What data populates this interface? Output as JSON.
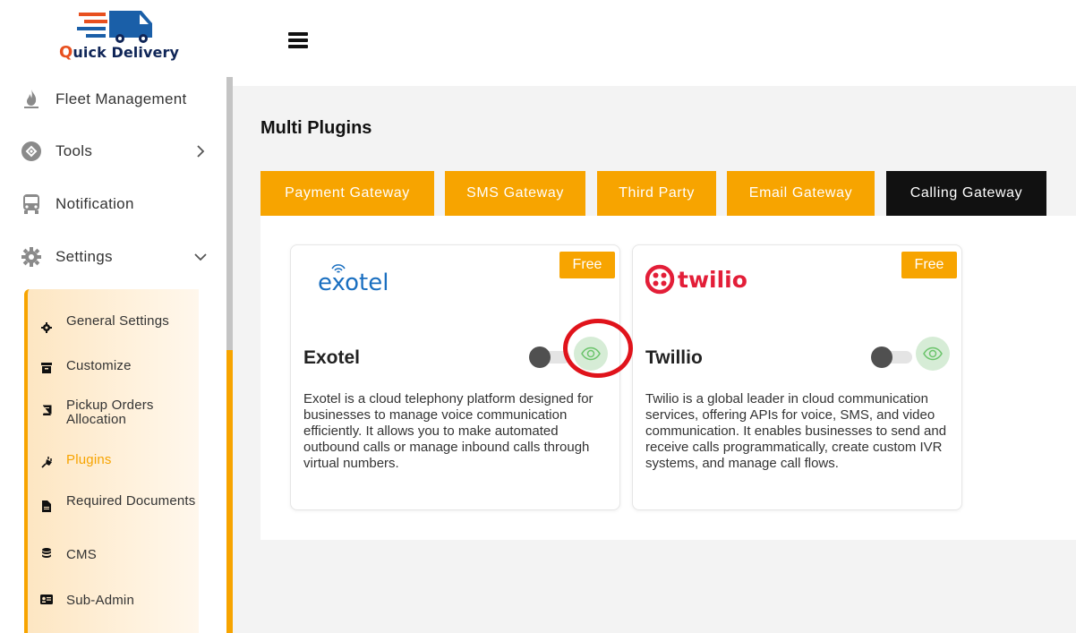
{
  "brand": {
    "name_first": "Q",
    "name_rest": "uick Delivery"
  },
  "sidebar": {
    "items": [
      {
        "label": "Fleet Management",
        "icon": "fire-icon"
      },
      {
        "label": "Tools",
        "icon": "tools-icon"
      },
      {
        "label": "Notification",
        "icon": "bus-icon"
      },
      {
        "label": "Settings",
        "icon": "gear-icon"
      }
    ],
    "submenu": [
      {
        "label": "General Settings",
        "icon": "gear-icon"
      },
      {
        "label": "Customize",
        "icon": "archive-icon"
      },
      {
        "label": "Pickup Orders Allocation",
        "icon": "book-icon"
      },
      {
        "label": "Plugins",
        "icon": "plug-icon",
        "active": true
      },
      {
        "label": "Required Documents",
        "icon": "file-icon"
      },
      {
        "label": "CMS",
        "icon": "database-icon"
      },
      {
        "label": "Sub-Admin",
        "icon": "id-card-icon"
      }
    ]
  },
  "main": {
    "title": "Multi Plugins",
    "tabs": [
      {
        "label": "Payment Gateway"
      },
      {
        "label": "SMS Gateway"
      },
      {
        "label": "Third Party"
      },
      {
        "label": "Email Gateway"
      },
      {
        "label": "Calling Gateway",
        "active": true
      }
    ],
    "plugins": [
      {
        "name": "Exotel",
        "logo_text": "exotel",
        "badge": "Free",
        "enabled": false,
        "description": "Exotel is a cloud telephony platform designed for businesses to manage voice communication efficiently. It allows you to make automated outbound calls or manage inbound calls through virtual numbers."
      },
      {
        "name": "Twillio",
        "logo_text": "twilio",
        "badge": "Free",
        "enabled": false,
        "description": "Twilio is a global leader in cloud communication services, offering APIs for voice, SMS, and video communication. It enables businesses to send and receive calls programmatically, create custom IVR systems, and manage call flows."
      }
    ]
  },
  "colors": {
    "accent": "#f7a400",
    "active_tab": "#111111",
    "eye_bg": "#d6ecd6",
    "highlight": "#e0131b",
    "twilio_red": "#e31e38",
    "exotel_blue": "#1a6fc0"
  }
}
